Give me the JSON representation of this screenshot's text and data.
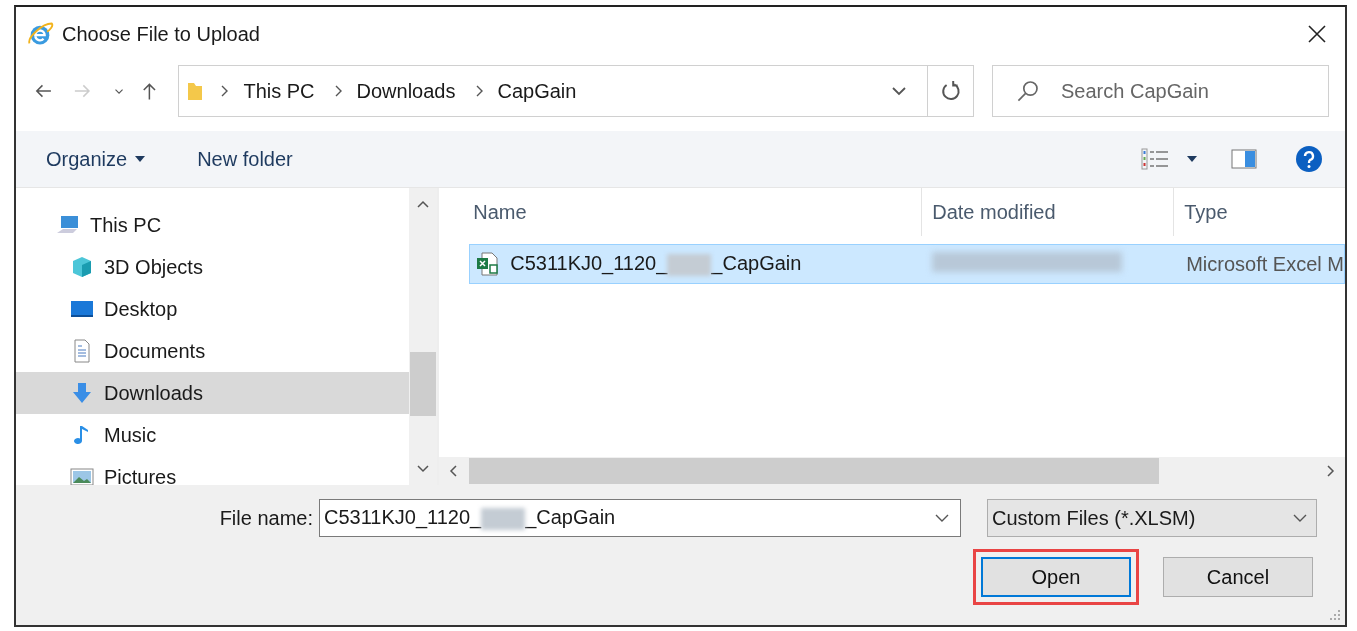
{
  "window": {
    "title": "Choose File to Upload"
  },
  "breadcrumb": [
    "This PC",
    "Downloads",
    "CapGain"
  ],
  "search": {
    "placeholder": "Search CapGain"
  },
  "toolbar": {
    "organize": "Organize",
    "new_folder": "New folder"
  },
  "nav": [
    {
      "label": "This PC",
      "kind": "pc",
      "selected": false,
      "children": [
        {
          "label": "3D Objects",
          "kind": "cube",
          "selected": false
        },
        {
          "label": "Desktop",
          "kind": "desktop",
          "selected": false
        },
        {
          "label": "Documents",
          "kind": "document",
          "selected": false
        },
        {
          "label": "Downloads",
          "kind": "download",
          "selected": true
        },
        {
          "label": "Music",
          "kind": "music",
          "selected": false
        },
        {
          "label": "Pictures",
          "kind": "pictures",
          "selected": false
        }
      ]
    }
  ],
  "columns": [
    "Name",
    "Date modified",
    "Type"
  ],
  "files": [
    {
      "name_start": "C5311KJ0_1120_",
      "name_end": "_CapGain",
      "type": "Microsoft Excel M",
      "selected": true
    }
  ],
  "file_name": {
    "label": "File name:",
    "value_start": "C5311KJ0_1120_",
    "value_end": "_CapGain"
  },
  "file_type": "Custom Files (*.XLSM)",
  "buttons": [
    {
      "label": "Open",
      "default": true,
      "highlighted": true
    },
    {
      "label": "Cancel",
      "default": false,
      "highlighted": false
    }
  ]
}
